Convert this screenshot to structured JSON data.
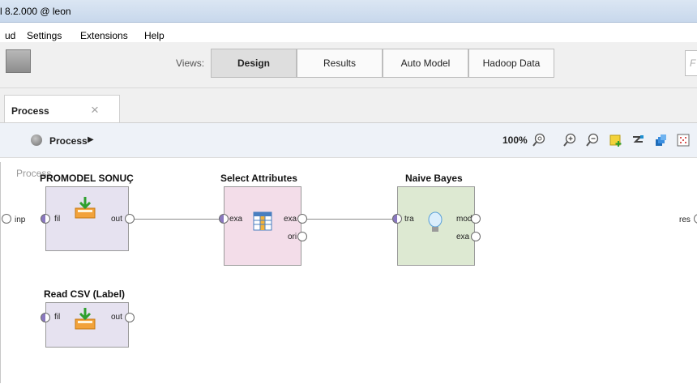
{
  "window": {
    "title": "l 8.2.000 @ leon"
  },
  "menu": {
    "items": [
      "ud",
      "Settings",
      "Extensions",
      "Help"
    ]
  },
  "toolbar": {
    "views_label": "Views:",
    "views": [
      "Design",
      "Results",
      "Auto Model",
      "Hadoop Data"
    ],
    "active_view": "Design",
    "search_placeholder": "F"
  },
  "tabs": {
    "process_tab": "Process",
    "close_symbol": "×"
  },
  "breadcrumb": {
    "label": "Process",
    "arrow": "▶"
  },
  "zoom": {
    "level": "100%"
  },
  "canvas": {
    "label": "Process",
    "left_port": "inp",
    "right_port": "res",
    "operators": {
      "promodel": {
        "title": "PROMODEL SONUÇ",
        "in_port": "fil",
        "out_port": "out"
      },
      "select_attributes": {
        "title": "Select Attributes",
        "in_port": "exa",
        "out_port1": "exa",
        "out_port2": "ori"
      },
      "naive_bayes": {
        "title": "Naive Bayes",
        "in_port": "tra",
        "out_port1": "mod",
        "out_port2": "exa"
      },
      "read_csv": {
        "title": "Read CSV (Label)",
        "in_port": "fil",
        "out_port": "out"
      }
    }
  },
  "colors": {
    "read_operator": "#e6e2f0",
    "select_operator": "#f3dde9",
    "model_operator": "#dde9d2",
    "input_port": "#8a78c0"
  }
}
